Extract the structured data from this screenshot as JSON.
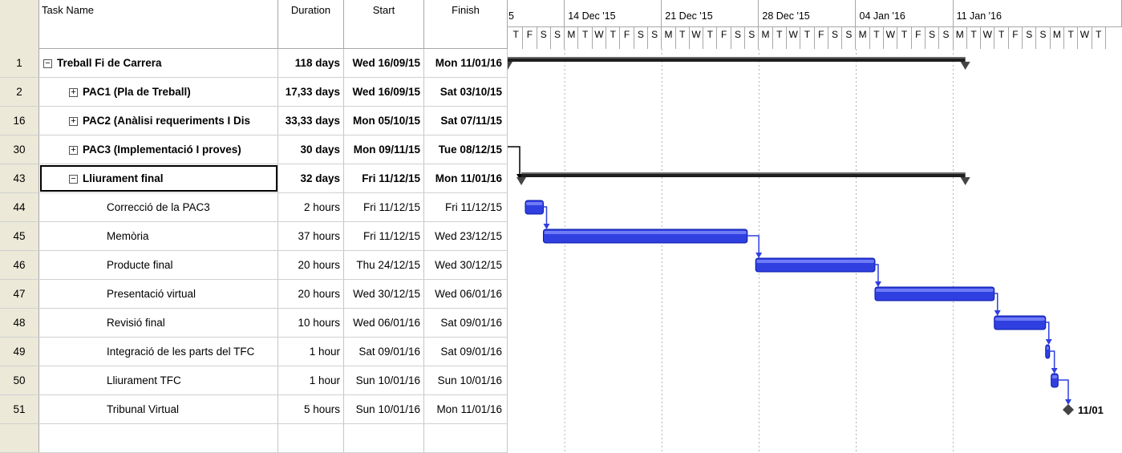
{
  "columns": {
    "task_name": "Task Name",
    "duration": "Duration",
    "start": "Start",
    "finish": "Finish"
  },
  "tasks": [
    {
      "id": "1",
      "name": "Treball Fi de Carrera",
      "duration": "118 days",
      "start": "Wed 16/09/15",
      "finish": "Mon 11/01/16",
      "summary": true,
      "expander": "−",
      "level": 0
    },
    {
      "id": "2",
      "name": "PAC1 (Pla de Treball)",
      "duration": "17,33 days",
      "start": "Wed 16/09/15",
      "finish": "Sat 03/10/15",
      "summary": true,
      "expander": "+",
      "level": 1
    },
    {
      "id": "16",
      "name": "PAC2 (Anàlisi requeriments I Dis",
      "duration": "33,33 days",
      "start": "Mon 05/10/15",
      "finish": "Sat 07/11/15",
      "summary": true,
      "expander": "+",
      "level": 1
    },
    {
      "id": "30",
      "name": "PAC3 (Implementació I proves)",
      "duration": "30 days",
      "start": "Mon 09/11/15",
      "finish": "Tue 08/12/15",
      "summary": true,
      "expander": "+",
      "level": 1
    },
    {
      "id": "43",
      "name": "Lliurament final",
      "duration": "32 days",
      "start": "Fri 11/12/15",
      "finish": "Mon 11/01/16",
      "summary": true,
      "expander": "−",
      "level": 1,
      "selected": true
    },
    {
      "id": "44",
      "name": "Correcció de la PAC3",
      "duration": "2 hours",
      "start": "Fri 11/12/15",
      "finish": "Fri 11/12/15",
      "summary": false,
      "level": 2
    },
    {
      "id": "45",
      "name": "Memòria",
      "duration": "37 hours",
      "start": "Fri 11/12/15",
      "finish": "Wed 23/12/15",
      "summary": false,
      "level": 2
    },
    {
      "id": "46",
      "name": "Producte final",
      "duration": "20 hours",
      "start": "Thu 24/12/15",
      "finish": "Wed 30/12/15",
      "summary": false,
      "level": 2
    },
    {
      "id": "47",
      "name": "Presentació virtual",
      "duration": "20 hours",
      "start": "Wed 30/12/15",
      "finish": "Wed 06/01/16",
      "summary": false,
      "level": 2
    },
    {
      "id": "48",
      "name": "Revisió final",
      "duration": "10 hours",
      "start": "Wed 06/01/16",
      "finish": "Sat 09/01/16",
      "summary": false,
      "level": 2
    },
    {
      "id": "49",
      "name": "Integració de les parts del TFC",
      "duration": "1 hour",
      "start": "Sat 09/01/16",
      "finish": "Sat 09/01/16",
      "summary": false,
      "level": 2
    },
    {
      "id": "50",
      "name": "Lliurament TFC",
      "duration": "1 hour",
      "start": "Sun 10/01/16",
      "finish": "Sun 10/01/16",
      "summary": false,
      "level": 2
    },
    {
      "id": "51",
      "name": "Tribunal Virtual",
      "duration": "5 hours",
      "start": "Sun 10/01/16",
      "finish": "Mon 11/01/16",
      "summary": false,
      "level": 2
    }
  ],
  "timescale": {
    "weeks": [
      "5",
      "14 Dec '15",
      "21 Dec '15",
      "28 Dec '15",
      "04 Jan '16",
      "11 Jan '16"
    ],
    "days": [
      "T",
      "F",
      "S",
      "S",
      "M",
      "T",
      "W",
      "T",
      "F",
      "S",
      "S",
      "M",
      "T",
      "W",
      "T",
      "F",
      "S",
      "S",
      "M",
      "T",
      "W",
      "T",
      "F",
      "S",
      "S",
      "M",
      "T",
      "W",
      "T",
      "F",
      "S",
      "S",
      "M",
      "T",
      "W",
      "T",
      "F",
      "S",
      "S",
      "M",
      "T",
      "W",
      "T"
    ]
  },
  "milestone_label": "11/01",
  "colors": {
    "bar": "#2f3fe0",
    "summary": "#1e1e1e",
    "header_bg": "#ece9d8"
  }
}
